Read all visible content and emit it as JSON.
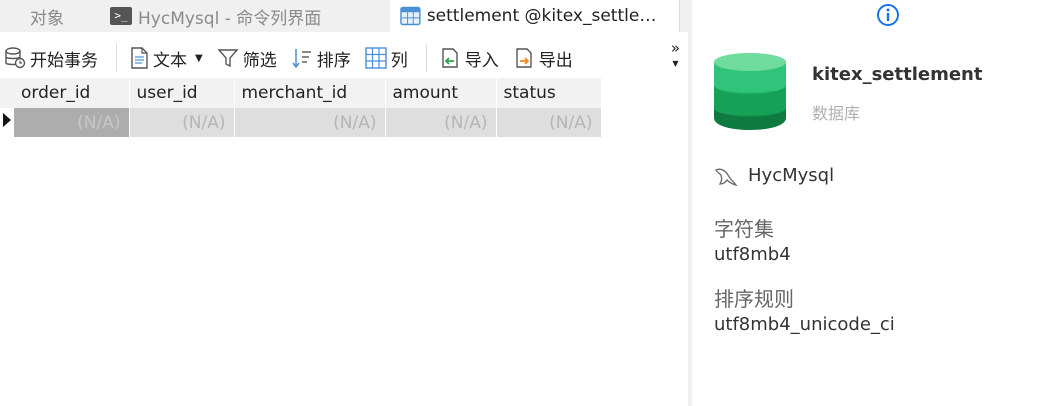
{
  "tabs": [
    {
      "label": "对象"
    },
    {
      "label": "HycMysql - 命令列界面",
      "icon": "terminal-icon"
    },
    {
      "label": "settlement @kitex_settleme...",
      "icon": "table-icon"
    }
  ],
  "toolbar": {
    "begin_transaction": "开始事务",
    "text": "文本",
    "filter": "筛选",
    "sort": "排序",
    "columns": "列",
    "import": "导入",
    "export": "导出",
    "more": "»"
  },
  "grid": {
    "columns": [
      "order_id",
      "user_id",
      "merchant_id",
      "amount",
      "status"
    ],
    "rows": [
      [
        "(N/A)",
        "(N/A)",
        "(N/A)",
        "(N/A)",
        "(N/A)"
      ]
    ]
  },
  "panel": {
    "db_name": "kitex_settlement",
    "db_type": "数据库",
    "connection": "HycMysql",
    "charset_label": "字符集",
    "charset_value": "utf8mb4",
    "collation_label": "排序规则",
    "collation_value": "utf8mb4_unicode_ci"
  },
  "colors": {
    "db_green_top": "#6fdc9e",
    "db_green_mid": "#1fb56a",
    "db_green_bottom": "#0e7a40",
    "info_blue": "#1a73e8"
  }
}
